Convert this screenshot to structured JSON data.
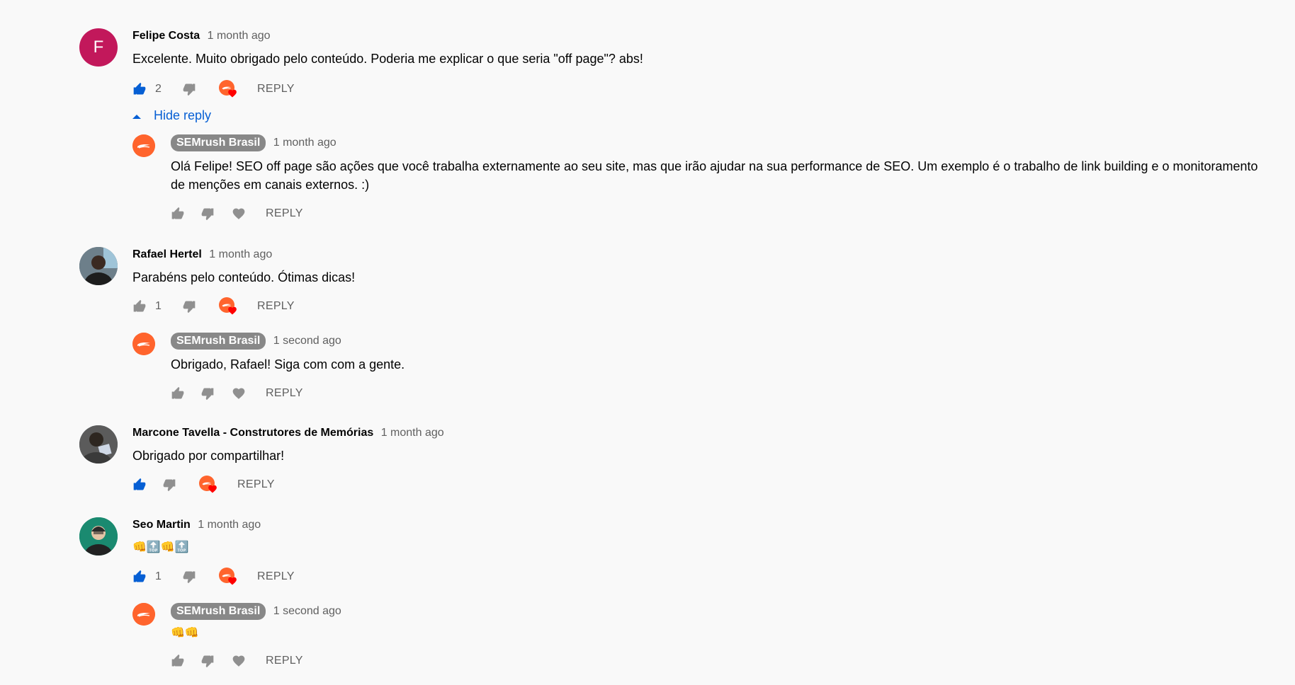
{
  "colors": {
    "accent": "#065fd4",
    "owner_badge": "#888888",
    "brand": "#ff642d",
    "heart": "#ff0000"
  },
  "reply_label": "REPLY",
  "comments": [
    {
      "author": "Felipe Costa",
      "time": "1 month ago",
      "avatar_letter": "F",
      "text": "Excelente. Muito obrigado pelo conteúdo. Poderia me explicar o que seria \"off page\"? abs!",
      "likes": "2",
      "liked": true,
      "hide_reply": "Hide reply",
      "reply": {
        "author": "SEMrush Brasil",
        "time": "1 month ago",
        "text": "Olá Felipe! SEO off page são ações que você trabalha externamente ao seu site, mas que irão ajudar na sua performance de SEO. Um exemplo é o trabalho de link building e o monitoramento de menções em canais externos. :)"
      }
    },
    {
      "author": "Rafael Hertel",
      "time": "1 month ago",
      "text": "Parabéns pelo conteúdo. Ótimas dicas!",
      "likes": "1",
      "liked": false,
      "reply": {
        "author": "SEMrush Brasil",
        "time": "1 second ago",
        "text": "Obrigado, Rafael! Siga com com a gente."
      }
    },
    {
      "author": "Marcone Tavella - Construtores de Memórias",
      "time": "1 month ago",
      "text": "Obrigado por compartilhar!",
      "likes": "",
      "liked": true
    },
    {
      "author": "Seo Martin",
      "time": "1 month ago",
      "text": "👊🔝👊🔝",
      "likes": "1",
      "liked": true,
      "reply": {
        "author": "SEMrush Brasil",
        "time": "1 second ago",
        "text": "👊👊"
      }
    }
  ]
}
